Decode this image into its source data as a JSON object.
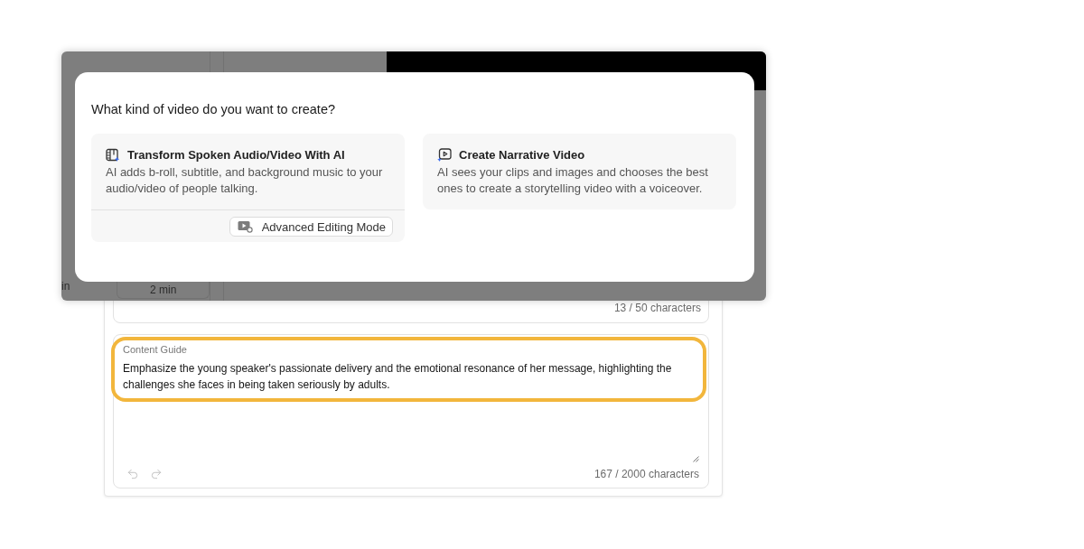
{
  "backdrop": {
    "left_fragment": "in",
    "duration_chip": "2 min"
  },
  "dialog": {
    "title": "What kind of video do you want to create?",
    "options": [
      {
        "kind": "transform",
        "title": "Transform Spoken Audio/Video With AI",
        "description": "AI adds b-roll, subtitle, and background music to your audio/video of people talking.",
        "action": "Advanced Editing Mode"
      },
      {
        "kind": "narrative",
        "title": "Create Narrative Video",
        "description": "AI sees your clips and images and chooses the best ones to create a storytelling video with a voiceover."
      }
    ]
  },
  "form": {
    "title_counter": "13 / 50 characters",
    "content_guide": {
      "label": "Content Guide",
      "value": "Emphasize the young speaker's passionate delivery and the emotional resonance of her message, highlighting the challenges she faces in being taken seriously by adults.",
      "counter": "167 / 2000 characters",
      "highlighted": true
    }
  }
}
